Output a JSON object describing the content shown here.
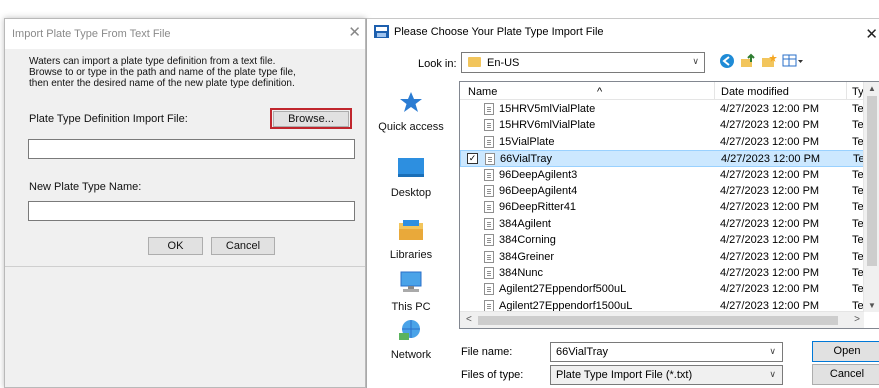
{
  "import_dialog": {
    "title": "Import Plate Type From Text File",
    "description_lines": [
      "Waters can import a plate type definition from a text file.",
      "Browse to or type in the path and name of the plate type file,",
      "then enter the desired name of the new plate type definition."
    ],
    "import_file_label": "Plate Type Definition Import File:",
    "browse_label": "Browse...",
    "import_file_value": "",
    "new_name_label": "New Plate Type Name:",
    "new_name_value": "",
    "ok_label": "OK",
    "cancel_label": "Cancel"
  },
  "file_dialog": {
    "title": "Please Choose Your Plate Type Import File",
    "look_in_label": "Look in:",
    "look_in_value": "En-US",
    "places": [
      {
        "label": "Quick access",
        "icon": "star-icon"
      },
      {
        "label": "Desktop",
        "icon": "desktop-icon"
      },
      {
        "label": "Libraries",
        "icon": "libraries-icon"
      },
      {
        "label": "This PC",
        "icon": "computer-icon"
      },
      {
        "label": "Network",
        "icon": "network-icon"
      }
    ],
    "columns": {
      "name": "Name",
      "date": "Date modified",
      "type": "Ty"
    },
    "files": [
      {
        "name": "15HRV5mlVialPlate",
        "date": "4/27/2023 12:00 PM",
        "type": "Te",
        "selected": false
      },
      {
        "name": "15HRV6mlVialPlate",
        "date": "4/27/2023 12:00 PM",
        "type": "Te",
        "selected": false
      },
      {
        "name": "15VialPlate",
        "date": "4/27/2023 12:00 PM",
        "type": "Te",
        "selected": false
      },
      {
        "name": "66VialTray",
        "date": "4/27/2023 12:00 PM",
        "type": "Te",
        "selected": true
      },
      {
        "name": "96DeepAgilent3",
        "date": "4/27/2023 12:00 PM",
        "type": "Te",
        "selected": false
      },
      {
        "name": "96DeepAgilent4",
        "date": "4/27/2023 12:00 PM",
        "type": "Te",
        "selected": false
      },
      {
        "name": "96DeepRitter41",
        "date": "4/27/2023 12:00 PM",
        "type": "Te",
        "selected": false
      },
      {
        "name": "384Agilent",
        "date": "4/27/2023 12:00 PM",
        "type": "Te",
        "selected": false
      },
      {
        "name": "384Corning",
        "date": "4/27/2023 12:00 PM",
        "type": "Te",
        "selected": false
      },
      {
        "name": "384Greiner",
        "date": "4/27/2023 12:00 PM",
        "type": "Te",
        "selected": false
      },
      {
        "name": "384Nunc",
        "date": "4/27/2023 12:00 PM",
        "type": "Te",
        "selected": false
      },
      {
        "name": "Agilent27Eppendorf500uL",
        "date": "4/27/2023 12:00 PM",
        "type": "Te",
        "selected": false
      },
      {
        "name": "Agilent27Eppendorf1500uL",
        "date": "4/27/2023 12:00 PM",
        "type": "Te",
        "selected": false
      }
    ],
    "file_name_label": "File name:",
    "file_name_value": "66VialTray",
    "file_type_label": "Files of type:",
    "file_type_value": "Plate Type Import File (*.txt)",
    "open_label": "Open",
    "cancel_label": "Cancel"
  },
  "colors": {
    "selection_bg": "#cce8ff",
    "highlight_border": "#c0262d",
    "default_button_border": "#0078d7"
  }
}
